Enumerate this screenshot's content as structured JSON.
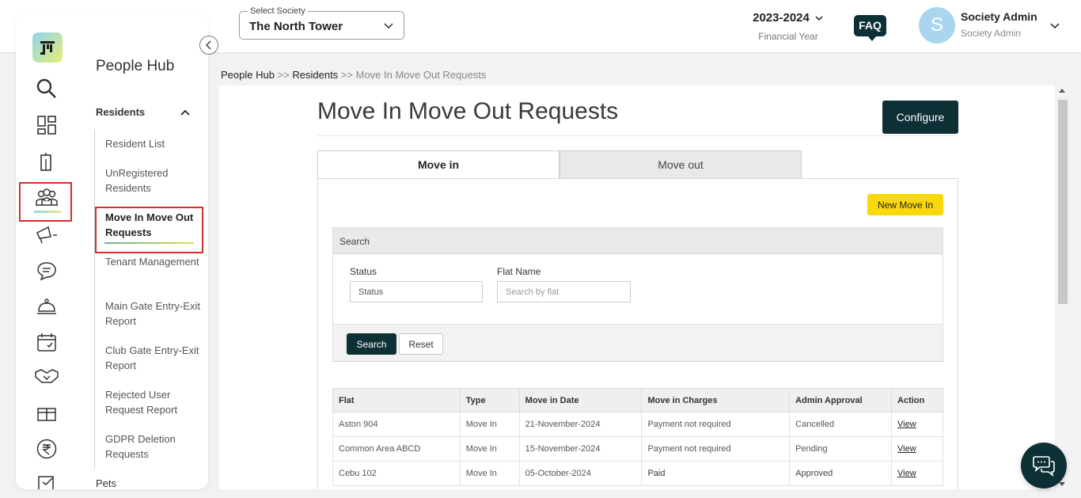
{
  "header": {
    "society_label": "Select Society",
    "society_value": "The North Tower",
    "year": "2023-2024",
    "year_sub": "Financial Year",
    "faq": "FAQ",
    "avatar_letter": "S",
    "user_name": "Society Admin",
    "user_role": "Society Admin"
  },
  "sidebar": {
    "hub_title": "People Hub",
    "section": "Residents",
    "items": [
      {
        "label": "Resident List"
      },
      {
        "label": "UnRegistered Residents"
      },
      {
        "label": "Move In Move Out Requests"
      },
      {
        "label": "Tenant Management"
      },
      {
        "label": "Main Gate Entry-Exit Report"
      },
      {
        "label": "Club Gate Entry-Exit Report"
      },
      {
        "label": "Rejected User Request Report"
      },
      {
        "label": "GDPR Deletion Requests"
      }
    ],
    "next_section": "Pets",
    "rail_icons": [
      "search-icon",
      "dashboard-icon",
      "building-icon",
      "people-icon",
      "megaphone-icon",
      "chat-icon",
      "service-bell-icon",
      "calendar-icon",
      "handshake-icon",
      "gift-icon",
      "rupee-icon",
      "checkbox-icon"
    ]
  },
  "breadcrumb": {
    "part1": "People Hub",
    "sep1": " >> ",
    "part2": "Residents",
    "sep2": " >> ",
    "current": "Move In Move Out Requests"
  },
  "main": {
    "title": "Move In Move Out Requests",
    "configure": "Configure",
    "tabs": [
      {
        "label": "Move in"
      },
      {
        "label": "Move out"
      }
    ],
    "new_button": "New Move In",
    "search": {
      "heading": "Search",
      "status_label": "Status",
      "status_value": "Status",
      "flat_label": "Flat Name",
      "flat_placeholder": "Search by flat",
      "search_btn": "Search",
      "reset_btn": "Reset"
    },
    "table": {
      "columns": [
        "Flat",
        "Type",
        "Move in Date",
        "Move in Charges",
        "Admin Approval",
        "Action"
      ],
      "rows": [
        {
          "flat": "Aston 904",
          "type": "Move In",
          "date": "21-November-2024",
          "charges": "Payment not required",
          "approval": "Cancelled",
          "action": "View"
        },
        {
          "flat": "Common Area ABCD",
          "type": "Move In",
          "date": "15-November-2024",
          "charges": "Payment not required",
          "approval": "Pending",
          "action": "View"
        },
        {
          "flat": "Cebu 102",
          "type": "Move In",
          "date": "05-October-2024",
          "charges": "Paid",
          "approval": "Approved",
          "action": "View"
        }
      ]
    }
  },
  "colors": {
    "brand_dark": "#0d2f36",
    "accent_yellow": "#f8d80a",
    "highlight_red": "#d62e2e",
    "status_green": "#8aaa3e",
    "status_orange": "#e08a16"
  }
}
